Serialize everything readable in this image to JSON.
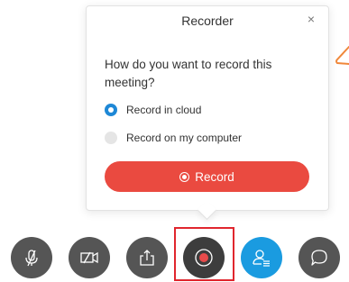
{
  "popover": {
    "title": "Recorder",
    "close_symbol": "×",
    "question": "How do you want to record this meeting?",
    "options": [
      {
        "label": "Record in cloud",
        "selected": true
      },
      {
        "label": "Record on my computer",
        "selected": false
      }
    ],
    "record_button_label": "Record"
  },
  "toolbar": {
    "buttons": [
      {
        "name": "mute-button",
        "icon": "microphone-muted-icon"
      },
      {
        "name": "video-button",
        "icon": "video-camera-off-icon"
      },
      {
        "name": "share-button",
        "icon": "share-upload-icon"
      },
      {
        "name": "record-button",
        "icon": "record-icon"
      },
      {
        "name": "participants-button",
        "icon": "participants-icon"
      },
      {
        "name": "chat-button",
        "icon": "chat-bubble-icon"
      }
    ]
  },
  "colors": {
    "accent_blue": "#1e88d6",
    "record_red": "#ea4a40",
    "highlight_red": "#e0262e",
    "toolbar_gray": "#555555",
    "participants_blue": "#1a9be0",
    "side_orange": "#f0873a"
  }
}
